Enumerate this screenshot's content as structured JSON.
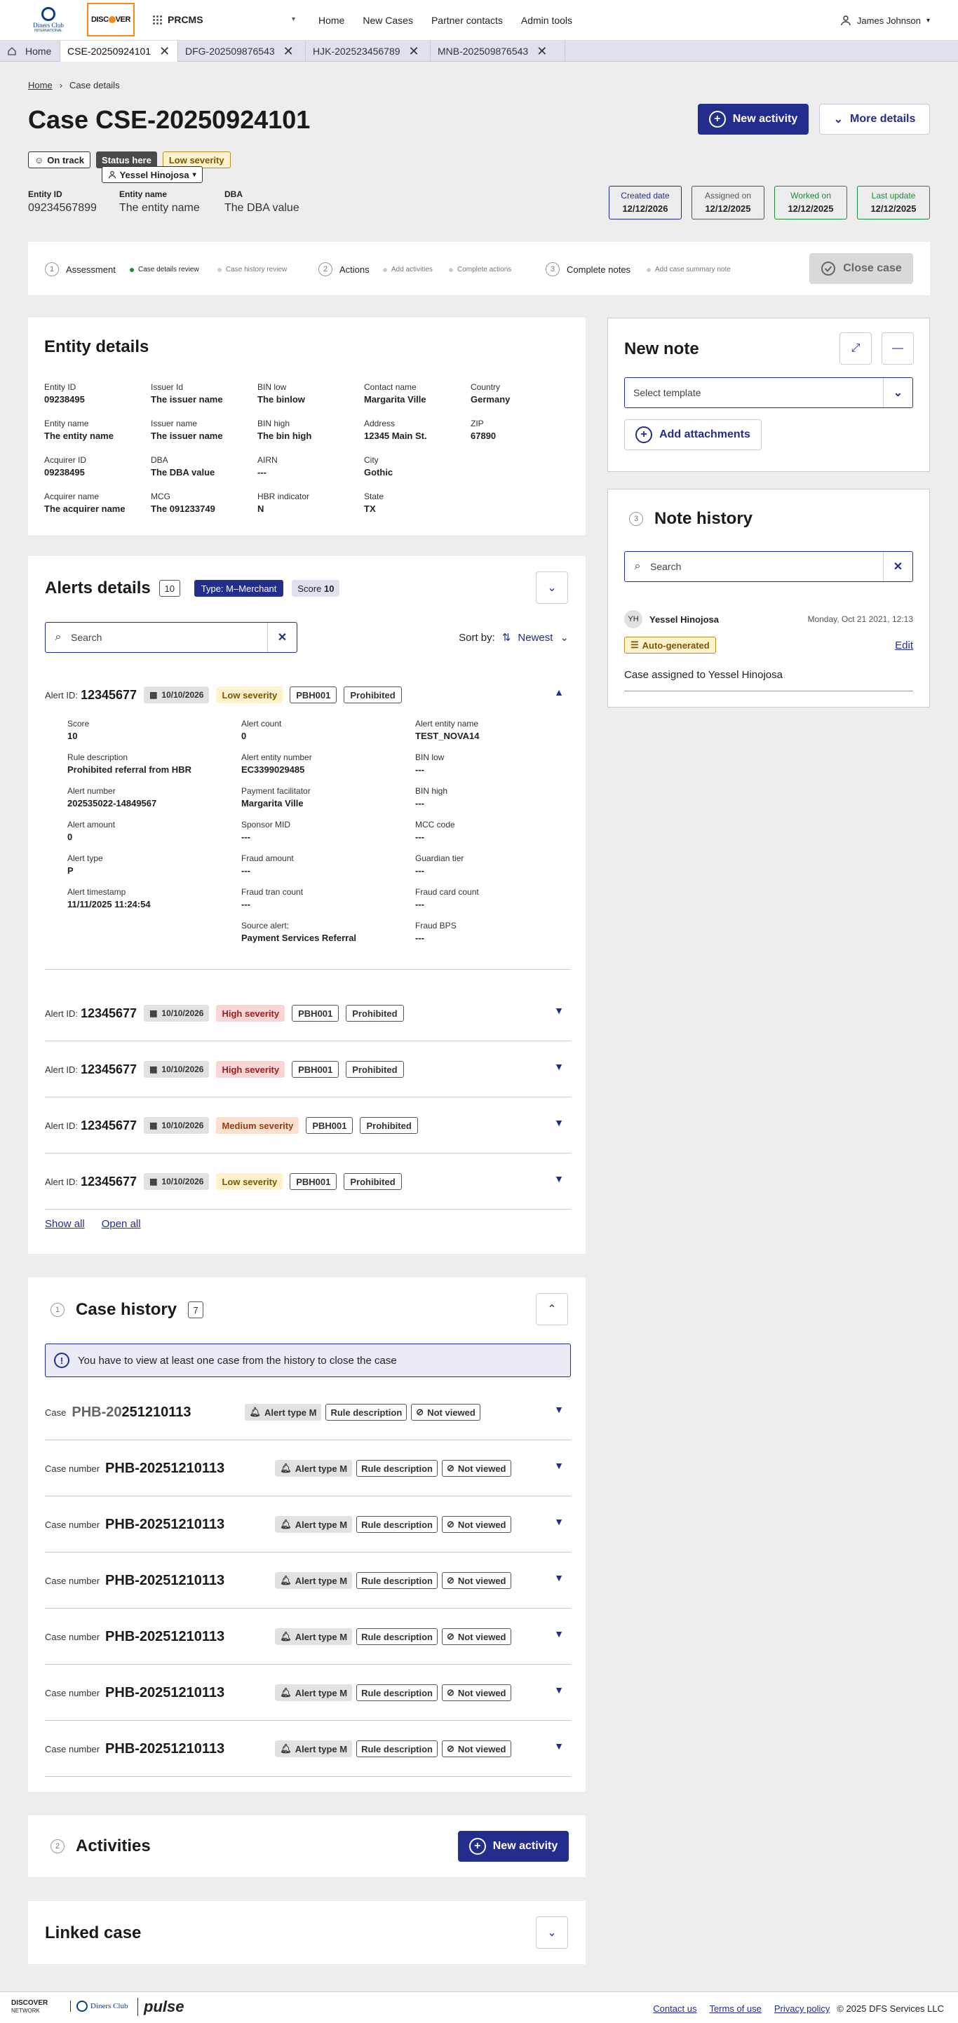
{
  "header": {
    "app": "PRCMS",
    "logo_dc": "Diners Club",
    "logo_dc_sub": "INTERNATIONAL",
    "logo_ds": "DISC",
    "logo_ds2": "VER",
    "nav": [
      "Home",
      "New Cases",
      "Partner contacts",
      "Admin tools"
    ],
    "user": "James Johnson"
  },
  "tabs": [
    "Home",
    "CSE-20250924101",
    "DFG-202509876543",
    "HJK-202523456789",
    "MNB-202509876543"
  ],
  "breadcrumb": {
    "home": "Home",
    "current": "Case details"
  },
  "case": {
    "title": "Case CSE-20250924101",
    "new_activity": "New activity",
    "more_details": "More details",
    "chips": {
      "on_track": "On track",
      "status": "Status here",
      "severity": "Low severity",
      "assignee": "Yessel Hinojosa"
    },
    "entity_id_k": "Entity ID",
    "entity_id": "09234567899",
    "entity_name_k": "Entity name",
    "entity_name": "The entity name",
    "dba_k": "DBA",
    "dba": "The DBA value",
    "dates": [
      {
        "k": "Created date",
        "v": "12/12/2026",
        "color": "#232d8d"
      },
      {
        "k": "Assigned on",
        "v": "12/12/2025",
        "color": "#555555"
      },
      {
        "k": "Worked on",
        "v": "12/12/2025",
        "color": "#1d8a3a"
      },
      {
        "k": "Last update",
        "v": "12/12/2025",
        "color": "#1d8a3a"
      }
    ]
  },
  "progress": {
    "steps": [
      {
        "n": "1",
        "label": "Assessment"
      },
      {
        "n": "2",
        "label": "Actions"
      },
      {
        "n": "3",
        "label": "Complete notes"
      }
    ],
    "subs": [
      "Case details review",
      "Case history review",
      "Add activities",
      "Complete actions",
      "Add case summary note"
    ],
    "close": "Close case"
  },
  "entity": {
    "title": "Entity details",
    "fields": [
      {
        "k": "Entity ID",
        "v": "09238495"
      },
      {
        "k": "Issuer Id",
        "v": "The issuer name"
      },
      {
        "k": "BIN low",
        "v": "The binlow"
      },
      {
        "k": "Contact name",
        "v": "Margarita Ville"
      },
      {
        "k": "Country",
        "v": "Germany"
      },
      {
        "k": "Entity name",
        "v": "The entity name"
      },
      {
        "k": "Issuer name",
        "v": "The issuer name"
      },
      {
        "k": "BIN high",
        "v": "The bin high"
      },
      {
        "k": "Address",
        "v": "12345 Main St."
      },
      {
        "k": "ZIP",
        "v": "67890"
      },
      {
        "k": "Acquirer ID",
        "v": "09238495"
      },
      {
        "k": "DBA",
        "v": "The DBA value"
      },
      {
        "k": "AIRN",
        "v": "---"
      },
      {
        "k": "City",
        "v": "Gothic"
      },
      {
        "k": "",
        "v": ""
      },
      {
        "k": "Acquirer name",
        "v": "The acquirer name"
      },
      {
        "k": "MCG",
        "v": "The 091233749"
      },
      {
        "k": "HBR indicator",
        "v": "N"
      },
      {
        "k": "State",
        "v": "TX"
      },
      {
        "k": "",
        "v": ""
      }
    ]
  },
  "alerts": {
    "title": "Alerts details",
    "count": "10",
    "type_pill": "Type: M–Merchant",
    "score_k": "Score",
    "score_v": "10",
    "search_ph": "Search",
    "sort_k": "Sort by:",
    "sort_v": "Newest",
    "id_label": "Alert ID:",
    "rows": [
      {
        "id": "12345677",
        "date": "10/10/2026",
        "sev": "Low severity",
        "sevc": "low",
        "code": "PBH001",
        "status": "Prohibited",
        "chev": "▲"
      },
      {
        "id": "12345677",
        "date": "10/10/2026",
        "sev": "High severity",
        "sevc": "high",
        "code": "PBH001",
        "status": "Prohibited",
        "chev": "▼"
      },
      {
        "id": "12345677",
        "date": "10/10/2026",
        "sev": "High severity",
        "sevc": "high",
        "code": "PBH001",
        "status": "Prohibited",
        "chev": "▼"
      },
      {
        "id": "12345677",
        "date": "10/10/2026",
        "sev": "Medium severity",
        "sevc": "med",
        "code": "PBH001",
        "status": "Prohibited",
        "chev": "▼"
      },
      {
        "id": "12345677",
        "date": "10/10/2026",
        "sev": "Low severity",
        "sevc": "low",
        "code": "PBH001",
        "status": "Prohibited",
        "chev": "▼"
      }
    ],
    "detail": [
      {
        "k": "Score",
        "v": "10"
      },
      {
        "k": "Alert count",
        "v": "0"
      },
      {
        "k": "Alert entity name",
        "v": "TEST_NOVA14"
      },
      {
        "k": "Rule description",
        "v": "Prohibited referral from HBR"
      },
      {
        "k": "Alert entity number",
        "v": "EC3399029485"
      },
      {
        "k": "BIN low",
        "v": "---"
      },
      {
        "k": "Alert  number",
        "v": "202535022-14849567"
      },
      {
        "k": "Payment facilitator",
        "v": "Margarita Ville"
      },
      {
        "k": "BIN high",
        "v": "---"
      },
      {
        "k": "Alert amount",
        "v": "0"
      },
      {
        "k": "Sponsor MID",
        "v": "---"
      },
      {
        "k": "MCC code",
        "v": "---"
      },
      {
        "k": "Alert type",
        "v": "P"
      },
      {
        "k": "Fraud amount",
        "v": "---"
      },
      {
        "k": "Guardian tier",
        "v": "---"
      },
      {
        "k": "Alert timestamp",
        "v": "11/11/2025 11:24:54"
      },
      {
        "k": "Fraud tran count",
        "v": "---"
      },
      {
        "k": "Fraud card count",
        "v": "---"
      },
      {
        "k": "",
        "v": ""
      },
      {
        "k": "Source alert:",
        "v": "Payment Services Referral"
      },
      {
        "k": "Fraud BPS",
        "v": "---"
      }
    ],
    "show_all": "Show all",
    "open_all": "Open all"
  },
  "history": {
    "n": "1",
    "title": "Case history",
    "count": "7",
    "info": "You have to view at least one case from the history to close the case",
    "rows": [
      {
        "k": "Case",
        "v1": "PHB-20",
        "v2": "251210113"
      },
      {
        "k": "Case number",
        "v1": "",
        "v2": "PHB-20251210113"
      },
      {
        "k": "Case number",
        "v1": "",
        "v2": "PHB-20251210113"
      },
      {
        "k": "Case number",
        "v1": "",
        "v2": "PHB-20251210113"
      },
      {
        "k": "Case number",
        "v1": "",
        "v2": "PHB-20251210113"
      },
      {
        "k": "Case number",
        "v1": "",
        "v2": "PHB-20251210113"
      },
      {
        "k": "Case number",
        "v1": "",
        "v2": "PHB-20251210113"
      }
    ],
    "alert_type": "Alert type M",
    "rule": "Rule description",
    "not_viewed": "Not viewed"
  },
  "activities": {
    "n": "2",
    "title": "Activities",
    "btn": "New activity"
  },
  "linked": {
    "title": "Linked case"
  },
  "note": {
    "title": "New note",
    "template_ph": "Select template",
    "attach": "Add attachments"
  },
  "note_history": {
    "n": "3",
    "title": "Note history",
    "search_ph": "Search",
    "initials": "YH",
    "author": "Yessel Hinojosa",
    "time": "Monday, Oct 21 2021, 12:13",
    "tag": "Auto-generated",
    "edit": "Edit",
    "text": "Case assigned to Yessel Hinojosa"
  },
  "footer": {
    "dn1": "DISCOVER",
    "dn2": "NETWORK",
    "dc": "Diners Club",
    "pulse": "pulse",
    "links": [
      "Contact us",
      "Terms of use",
      "Privacy policy"
    ],
    "copy": "© 2025 DFS Services LLC"
  }
}
